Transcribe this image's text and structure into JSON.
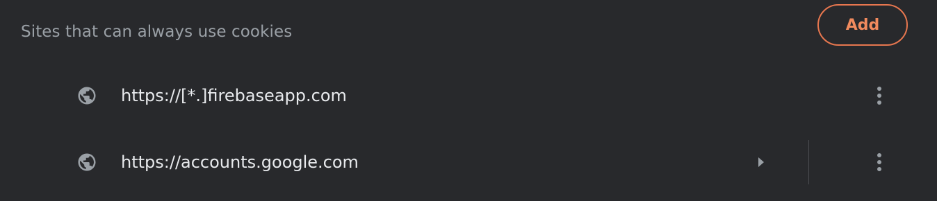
{
  "section": {
    "title": "Sites that can always use cookies",
    "add_label": "Add"
  },
  "sites": [
    {
      "url": "https://[*.]firebaseapp.com",
      "icon": "globe-icon",
      "has_expand": false
    },
    {
      "url": "https://accounts.google.com",
      "icon": "globe-icon",
      "has_expand": true
    }
  ],
  "colors": {
    "background": "#28292c",
    "accent": "#f28b5e",
    "title_text": "#9aa0a6",
    "row_text": "#e8eaed",
    "icon": "#9aa0a6"
  }
}
